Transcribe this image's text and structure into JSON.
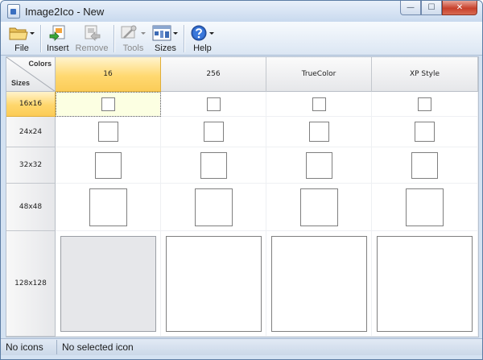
{
  "window": {
    "title": "Image2Ico - New",
    "controls": {
      "minimize": "—",
      "maximize": "☐",
      "close": "✕"
    }
  },
  "toolbar": {
    "buttons": [
      {
        "label": "File",
        "icon": "folder-icon",
        "enabled": true,
        "dropdown": true
      },
      {
        "label": "Insert",
        "icon": "insert-icon",
        "enabled": true,
        "dropdown": false
      },
      {
        "label": "Remove",
        "icon": "remove-icon",
        "enabled": false,
        "dropdown": false
      },
      {
        "label": "Tools",
        "icon": "tools-icon",
        "enabled": false,
        "dropdown": true
      },
      {
        "label": "Sizes",
        "icon": "sizes-icon",
        "enabled": true,
        "dropdown": true
      },
      {
        "label": "Help",
        "icon": "help-icon",
        "enabled": true,
        "dropdown": true
      }
    ]
  },
  "grid": {
    "corner": {
      "colors_label": "Colors",
      "sizes_label": "Sizes"
    },
    "columns": [
      "16",
      "256",
      "TrueColor",
      "XP Style"
    ],
    "rows": [
      "16x16",
      "24x24",
      "32x32",
      "48x48",
      "128x128"
    ],
    "selected_column": "16",
    "selected_row": "16x16",
    "highlighted_cell": "16 × 16x16",
    "filled_cell": "16 × 128x128"
  },
  "status": {
    "left": "No icons",
    "right": "No selected icon"
  },
  "colors": {
    "selection_gold": "#ffd971",
    "selected_cell": "#fcffe2",
    "window_frame": "#d4e2f2"
  }
}
